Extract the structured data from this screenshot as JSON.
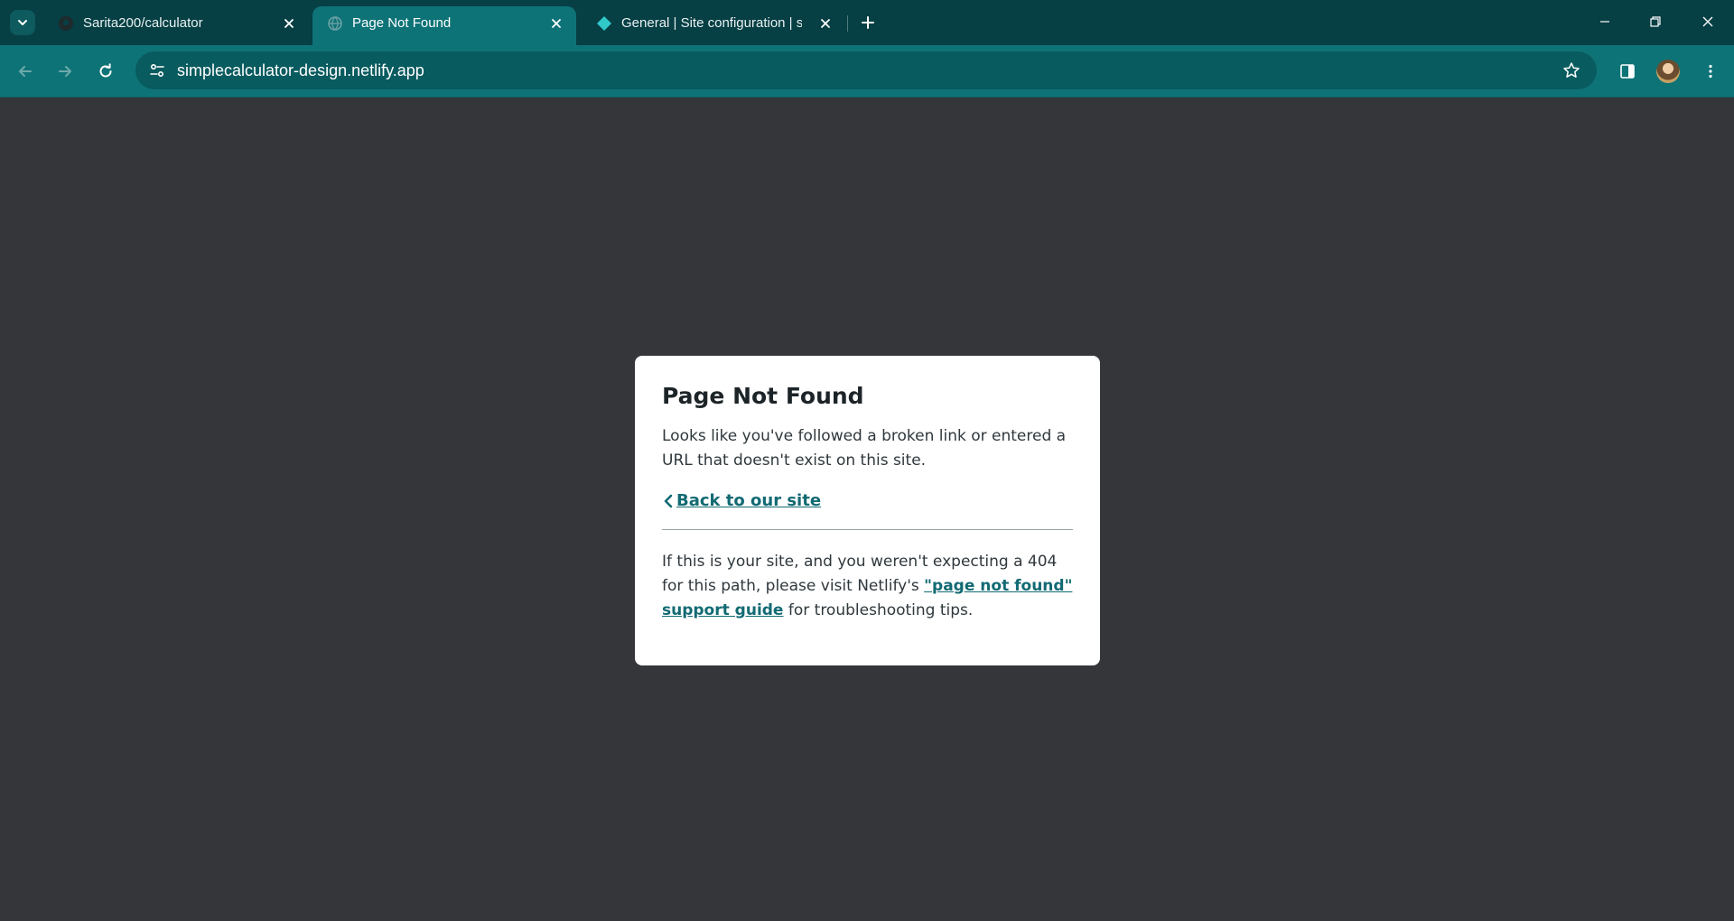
{
  "browser": {
    "tabs": [
      {
        "title": "Sarita200/calculator",
        "favicon": "github-icon",
        "active": false
      },
      {
        "title": "Page Not Found",
        "favicon": "globe-icon",
        "active": true
      },
      {
        "title": "General | Site configuration | simplecalculator-design",
        "favicon": "netlify-icon",
        "active": false
      }
    ],
    "url": "simplecalculator-design.netlify.app",
    "accent_color": "#0e7377",
    "tabstrip_color": "#063f44"
  },
  "page": {
    "heading": "Page Not Found",
    "message": "Looks like you've followed a broken link or entered a URL that doesn't exist on this site.",
    "back_link": "Back to our site",
    "help_text_before": "If this is your site, and you weren't expecting a 404 for this path, please visit Netlify's ",
    "help_link": "\"page not found\" support guide",
    "help_text_after": " for troubleshooting tips.",
    "background_color": "#35363a",
    "link_color": "#126a73"
  }
}
